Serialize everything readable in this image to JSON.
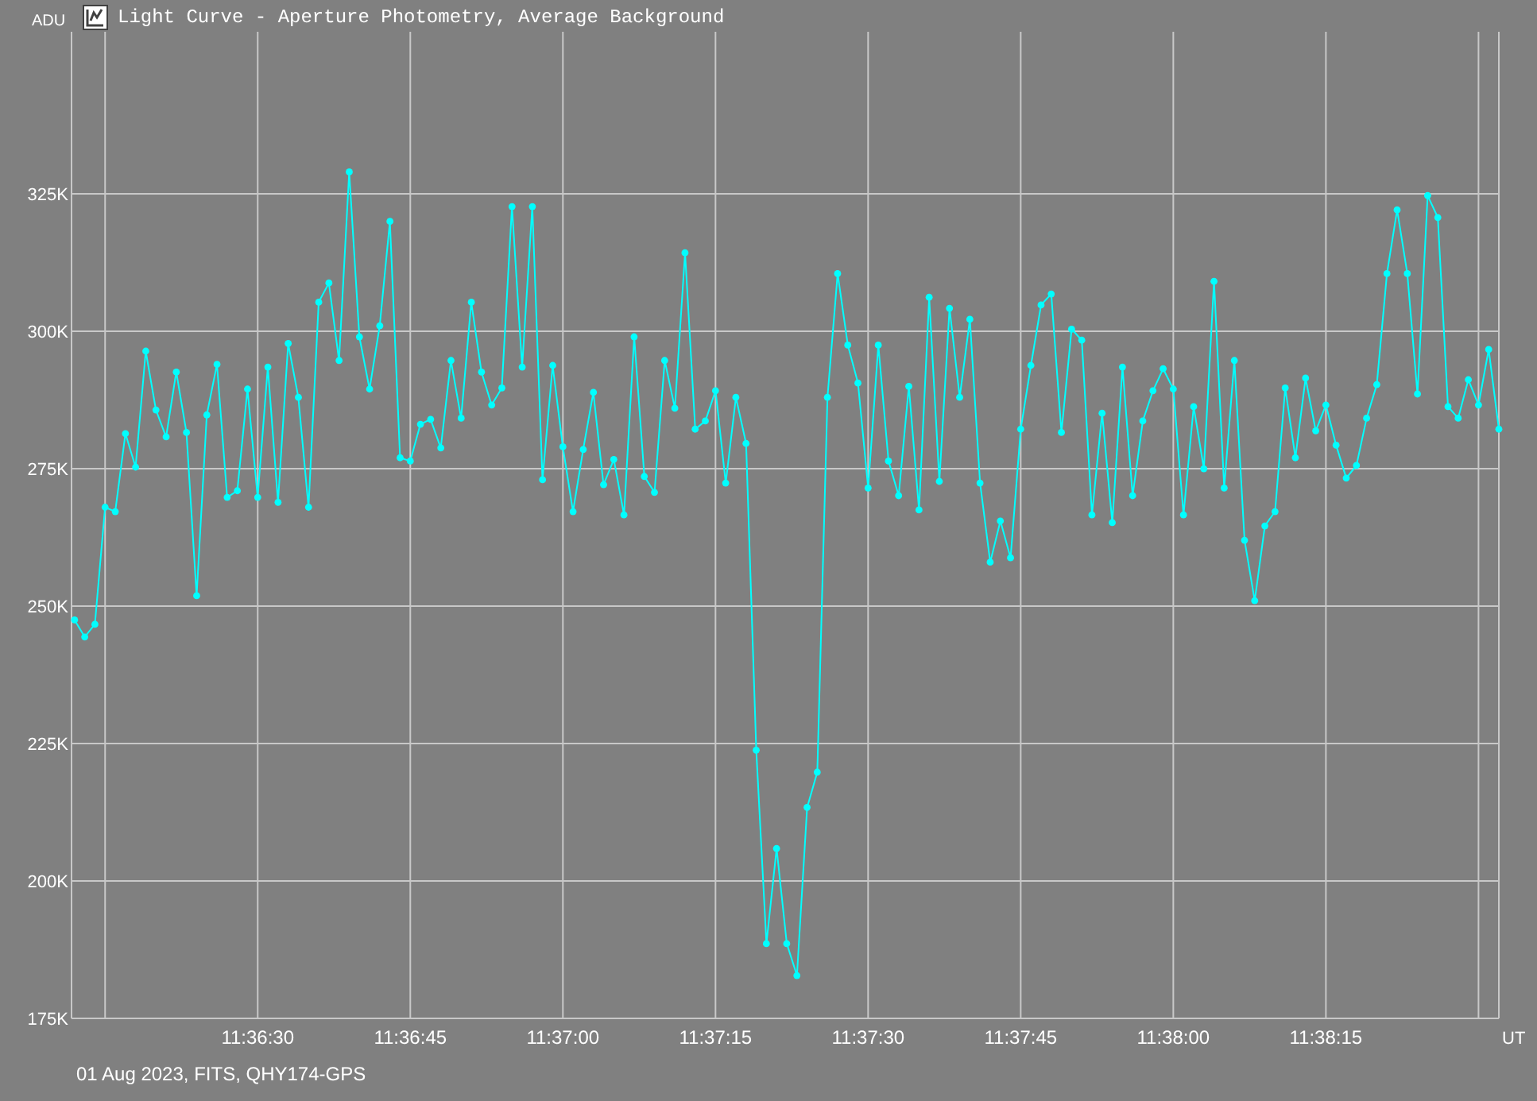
{
  "window": {
    "title": "Light Curve - Aperture Photometry, Average Background"
  },
  "chart": {
    "chart_data": {
      "type": "line",
      "grid": true,
      "ylabel": "ADU",
      "xlabel": "UT",
      "ylim": [
        175,
        354.5
      ],
      "yticks": [
        {
          "value": 175,
          "label": "175K"
        },
        {
          "value": 200,
          "label": "200K"
        },
        {
          "value": 225,
          "label": "225K"
        },
        {
          "value": 250,
          "label": "250K"
        },
        {
          "value": 275,
          "label": "275K"
        },
        {
          "value": 300,
          "label": "300K"
        },
        {
          "value": 325,
          "label": "325K"
        }
      ],
      "categories": [
        null,
        null,
        null,
        null,
        null,
        null,
        null,
        null,
        null,
        null,
        null,
        null,
        null,
        null,
        null,
        null,
        null,
        null,
        "11:36:30",
        null,
        null,
        null,
        null,
        null,
        null,
        null,
        null,
        null,
        null,
        null,
        null,
        null,
        null,
        "11:36:45",
        null,
        null,
        null,
        null,
        null,
        null,
        null,
        null,
        null,
        null,
        null,
        null,
        null,
        null,
        "11:37:00",
        null,
        null,
        null,
        null,
        null,
        null,
        null,
        null,
        null,
        null,
        null,
        null,
        null,
        null,
        "11:37:15",
        null,
        null,
        null,
        null,
        null,
        null,
        null,
        null,
        null,
        null,
        null,
        null,
        null,
        null,
        "11:37:30",
        null,
        null,
        null,
        null,
        null,
        null,
        null,
        null,
        null,
        null,
        null,
        null,
        null,
        null,
        "11:37:45",
        null,
        null,
        null,
        null,
        null,
        null,
        null,
        null,
        null,
        null,
        null,
        null,
        null,
        null,
        "11:38:00",
        null,
        null,
        null,
        null,
        null,
        null,
        null,
        null,
        null,
        null,
        null,
        null,
        null,
        null,
        "11:38:15",
        null,
        null,
        null,
        null,
        null,
        null,
        null,
        null,
        null,
        null,
        null,
        null,
        null,
        null,
        null,
        null,
        null
      ],
      "series": [
        {
          "color": "#00ffff",
          "marker": "circle",
          "values": [
            247.5,
            244.4,
            246.7,
            268,
            267.2,
            281.4,
            275.3,
            296.4,
            285.7,
            280.8,
            292.6,
            281.6,
            251.9,
            284.8,
            294,
            269.8,
            271,
            289.5,
            269.8,
            293.5,
            268.9,
            297.8,
            288,
            268,
            305.3,
            308.8,
            294.7,
            329,
            299,
            289.5,
            301,
            320,
            277,
            276.4,
            283.1,
            284,
            278.8,
            294.7,
            284.2,
            305.3,
            292.6,
            286.6,
            289.7,
            322.7,
            293.5,
            322.7,
            273,
            293.8,
            279,
            267.2,
            278.5,
            288.9,
            272.1,
            276.7,
            266.6,
            299,
            273.6,
            270.7,
            294.7,
            286,
            314.3,
            282.2,
            283.7,
            289.2,
            272.4,
            288,
            279.6,
            223.8,
            188.6,
            205.9,
            188.6,
            182.8,
            213.4,
            219.8,
            288,
            310.5,
            297.5,
            290.6,
            271.5,
            297.5,
            276.4,
            270.1,
            290,
            267.5,
            306.2,
            272.7,
            304.2,
            288,
            302.2,
            272.4,
            258,
            265.5,
            258.8,
            282.2,
            293.8,
            304.8,
            306.8,
            281.6,
            300.4,
            298.4,
            266.6,
            285.1,
            265.2,
            293.5,
            270.1,
            283.7,
            289.2,
            293.2,
            289.5,
            266.6,
            286.3,
            275,
            309.1,
            271.5,
            294.7,
            262,
            251,
            264.6,
            267.2,
            289.7,
            277,
            291.5,
            281.9,
            286.6,
            279.3,
            273.3,
            275.6,
            284.2,
            290.3,
            310.5,
            322.1,
            310.5,
            288.6,
            324.7,
            320.7,
            286.3,
            284.2,
            291.2,
            286.6,
            296.7,
            282.2
          ]
        }
      ]
    }
  },
  "footer": "01 Aug 2023, FITS, QHY174-GPS"
}
